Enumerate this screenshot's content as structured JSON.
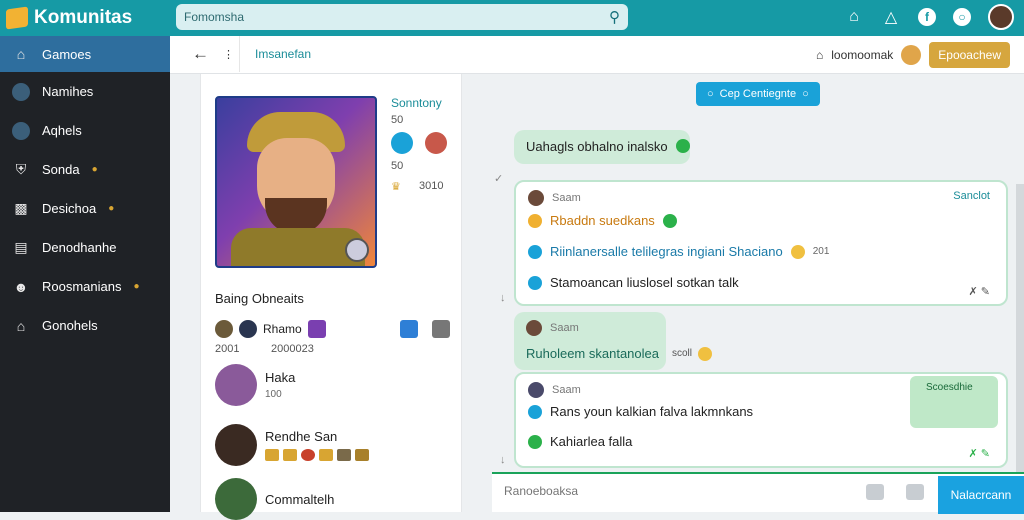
{
  "app": {
    "title": "Komunitas"
  },
  "search": {
    "value": "Fomomsha"
  },
  "sidebar": {
    "items": [
      {
        "label": "Gamoes",
        "icon": "home-icon"
      },
      {
        "label": "Namihes",
        "icon": "avatar-icon"
      },
      {
        "label": "Aqhels",
        "icon": "avatar-icon"
      },
      {
        "label": "Sonda",
        "icon": "shield-icon"
      },
      {
        "label": "Desichoa",
        "icon": "briefcase-icon"
      },
      {
        "label": "Denodhanhe",
        "icon": "clipboard-icon"
      },
      {
        "label": "Roosmanians",
        "icon": "people-icon"
      },
      {
        "label": "Gonohels",
        "icon": "home-icon"
      }
    ]
  },
  "subheader": {
    "title": "Imsanefan",
    "right_label": "loomoomak",
    "gold_button": "Epooachew"
  },
  "profile": {
    "name": "Sonntony",
    "stat1": "50",
    "stat2": "50",
    "stat3": "3010",
    "section_title": "Baing Obneaits",
    "strip_label": "Rhamo",
    "strip_num1": "2001",
    "strip_num2": "2000023",
    "friends": [
      {
        "name": "Haka",
        "sub": "100"
      },
      {
        "name": "Rendhe San",
        "sub": ""
      },
      {
        "name": "Commaltelh",
        "sub": ""
      }
    ]
  },
  "chat": {
    "top_button": "Cep Centiegnte",
    "messages": [
      {
        "text": "Uahagls obhalno inalsko"
      },
      {
        "sender": "Saam",
        "status": "Sanclot",
        "lines": [
          "Rbaddn suedkans",
          "Riinlanersalle telilegras ingiani Shaciano",
          "Stamoancan liuslosel sotkan talk"
        ],
        "count": "201"
      },
      {
        "sender": "Saam",
        "text": "Ruholeem skantanolea",
        "suffix": "scoll"
      },
      {
        "sender": "Saam",
        "badge": "Scoesdhie",
        "lines": [
          "Rans youn kalkian falva lakmnkans",
          "Kahiarlea falla"
        ]
      }
    ]
  },
  "composer": {
    "placeholder": "Ranoeboaksa",
    "send_label": "Nalacrcann"
  }
}
